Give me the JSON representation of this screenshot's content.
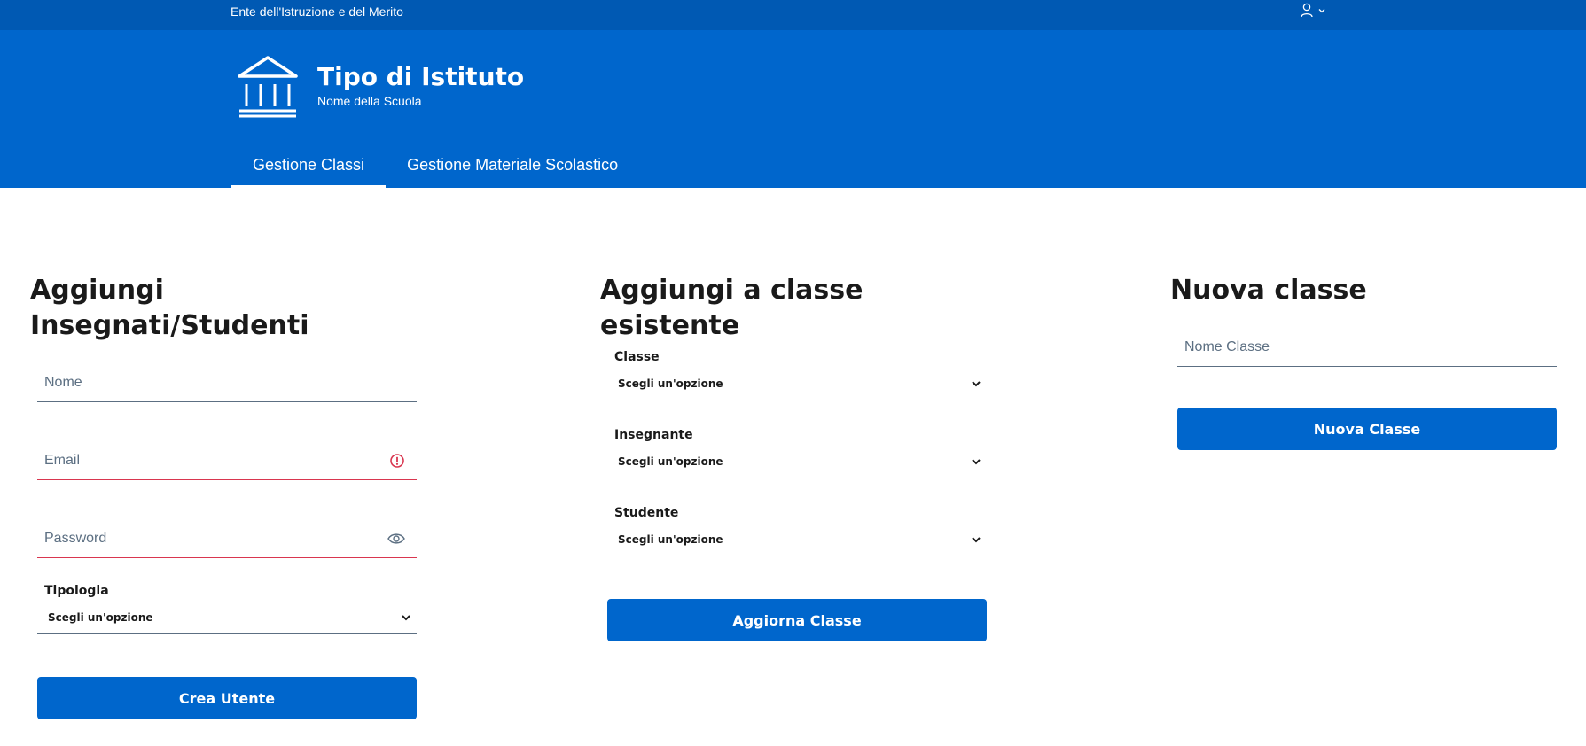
{
  "header": {
    "organization": "Ente dell'Istruzione e del Merito",
    "title": "Tipo di Istituto",
    "subtitle": "Nome della Scuola",
    "user_icon": "user-icon",
    "logo_icon": "institution-icon"
  },
  "nav": {
    "tabs": [
      {
        "label": "Gestione Classi",
        "active": true
      },
      {
        "label": "Gestione Materiale Scolastico",
        "active": false
      }
    ]
  },
  "add_users": {
    "heading_line1": "Aggiungi",
    "heading_line2": "Insegnati/Studenti",
    "name_placeholder": "Nome",
    "email_placeholder": "Email",
    "password_placeholder": "Password",
    "type_label": "Tipologia",
    "type_value": "Scegli un'opzione",
    "submit_label": "Crea Utente"
  },
  "add_to_class": {
    "heading_line1": "Aggiungi a classe",
    "heading_line2": "esistente",
    "class_label": "Classe",
    "class_value": "Scegli un'opzione",
    "teacher_label": "Insegnante",
    "teacher_value": "Scegli un'opzione",
    "student_label": "Studente",
    "student_value": "Scegli un'opzione",
    "submit_label": "Aggiorna Classe"
  },
  "new_class": {
    "heading": "Nuova classe",
    "name_placeholder": "Nome Classe",
    "submit_label": "Nuova Classe"
  },
  "colors": {
    "slim_header": "#0059b3",
    "primary": "#0066cc",
    "error": "#d9364f",
    "border": "#5c6f82"
  }
}
